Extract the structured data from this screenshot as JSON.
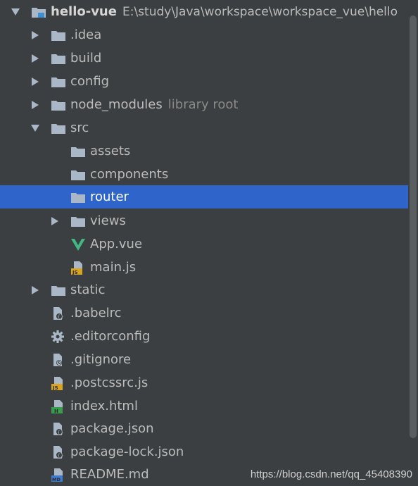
{
  "tree": {
    "root": {
      "label": "hello-vue",
      "path": "E:\\study\\Java\\workspace\\workspace_vue\\hello"
    },
    "items": [
      {
        "label": ".idea",
        "icon": "folder-icon"
      },
      {
        "label": "build",
        "icon": "folder-icon"
      },
      {
        "label": "config",
        "icon": "folder-icon"
      },
      {
        "label": "node_modules",
        "hint": "library root",
        "icon": "folder-icon"
      },
      {
        "label": "src",
        "icon": "folder-icon"
      },
      {
        "label": "assets",
        "icon": "folder-icon"
      },
      {
        "label": "components",
        "icon": "folder-icon"
      },
      {
        "label": "router",
        "icon": "folder-icon"
      },
      {
        "label": "views",
        "icon": "folder-icon"
      },
      {
        "label": "App.vue",
        "icon": "vue-file-icon"
      },
      {
        "label": "main.js",
        "icon": "js-file-icon"
      },
      {
        "label": "static",
        "icon": "folder-icon"
      },
      {
        "label": ".babelrc",
        "icon": "config-file-icon"
      },
      {
        "label": ".editorconfig",
        "icon": "gear-icon"
      },
      {
        "label": ".gitignore",
        "icon": "ignore-file-icon"
      },
      {
        "label": ".postcssrc.js",
        "icon": "js-file-icon"
      },
      {
        "label": "index.html",
        "icon": "html-file-icon"
      },
      {
        "label": "package.json",
        "icon": "json-file-icon"
      },
      {
        "label": "package-lock.json",
        "icon": "json-file-icon"
      },
      {
        "label": "README.md",
        "icon": "markdown-file-icon"
      }
    ],
    "selected": "router"
  },
  "watermark": "https://blog.csdn.net/qq_45408390",
  "colors": {
    "background": "#3c3f41",
    "selection": "#2f65ca",
    "folder": "#a9b7c6",
    "vue": "#41b883",
    "js_badge": "#d9a420",
    "html_badge": "#3a9d4e",
    "md_badge": "#3d7bd1"
  }
}
